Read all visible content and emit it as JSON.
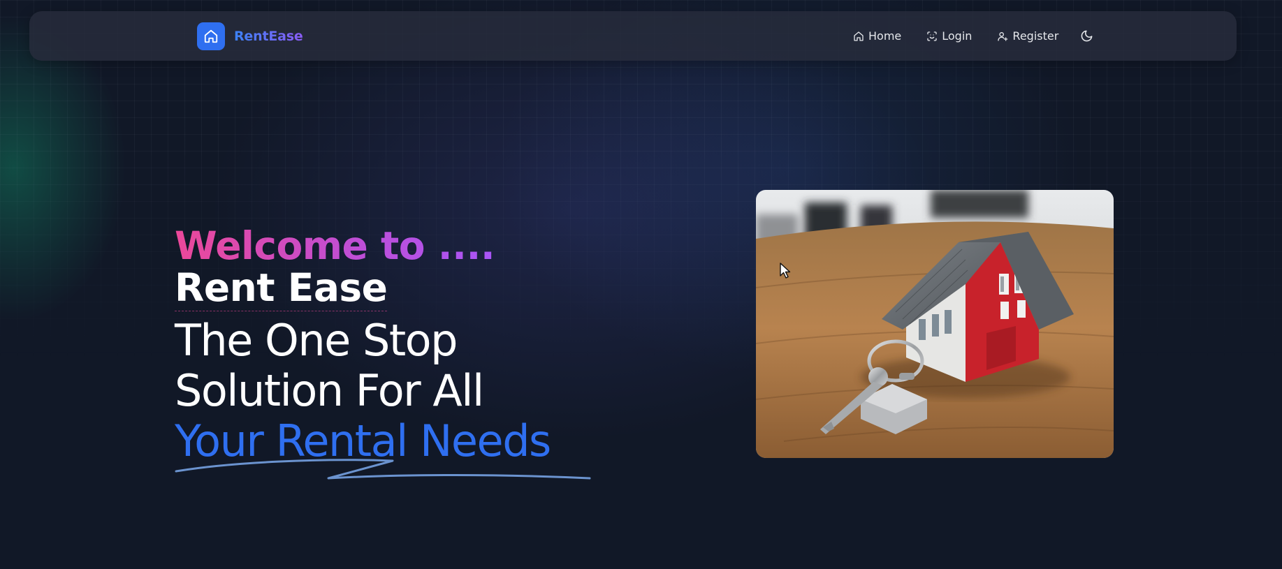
{
  "brand": {
    "name": "RentEase",
    "logo_icon": "home-icon",
    "accent_color": "#2f6ff0"
  },
  "nav": {
    "items": [
      {
        "label": "Home",
        "icon": "home-icon"
      },
      {
        "label": "Login",
        "icon": "scan-face-icon"
      },
      {
        "label": "Register",
        "icon": "user-plus-icon"
      }
    ],
    "theme_toggle_icon": "moon-icon"
  },
  "hero": {
    "welcome_prefix": "Welcome to ....",
    "welcome_brand": "Rent Ease",
    "tagline_line1": "The One Stop",
    "tagline_line2": "Solution For All",
    "tagline_highlight": "Your Rental Needs",
    "image_subject": "model house with keys on a wooden table"
  },
  "colors": {
    "background": "#111827",
    "highlight_blue": "#2f6ff0",
    "gradient_pink": "#ec4899",
    "gradient_purple": "#a855f7"
  }
}
